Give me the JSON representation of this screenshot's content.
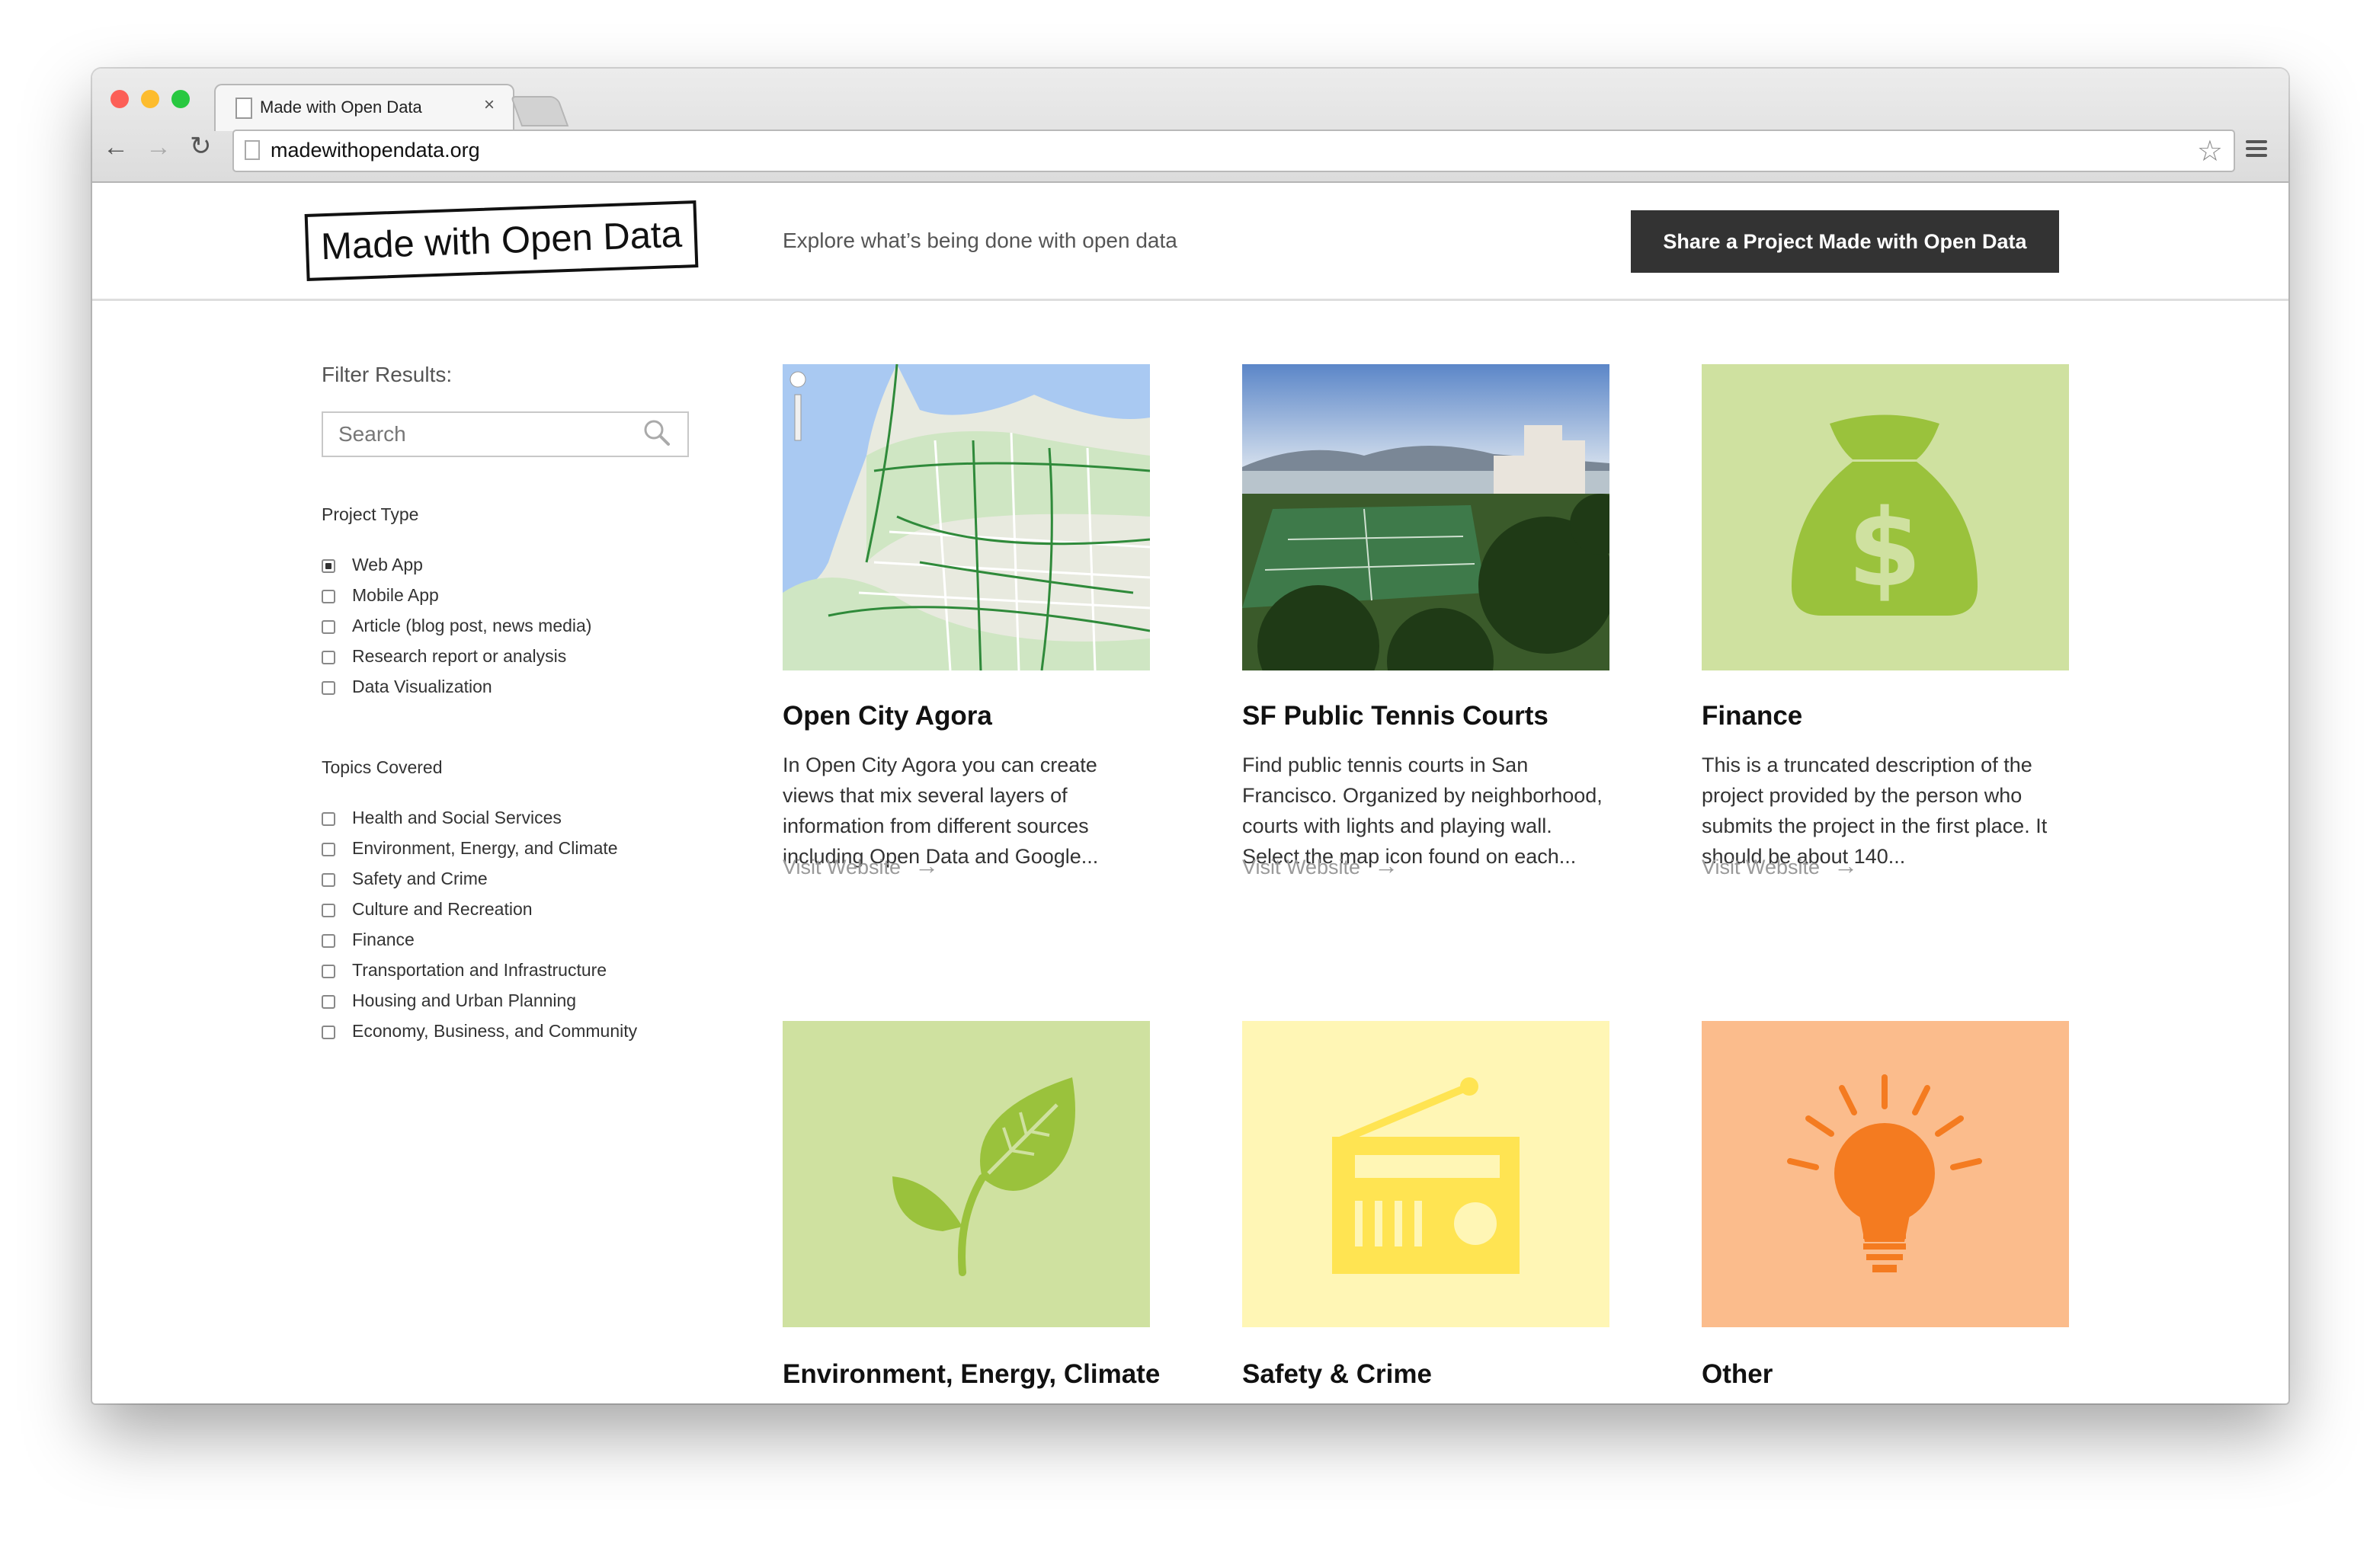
{
  "browser": {
    "tab_title": "Made with Open Data",
    "tab_close": "×",
    "url": "madewithopendata.org",
    "back_icon": "←",
    "forward_icon": "→",
    "reload_icon": "↻",
    "star_icon": "☆"
  },
  "header": {
    "logo_text": "Made with Open Data",
    "tagline": "Explore what’s being done with open data",
    "share_button": "Share a Project Made with Open Data"
  },
  "sidebar": {
    "filter_label": "Filter Results:",
    "search_placeholder": "Search",
    "project_type_title": "Project Type",
    "project_types": [
      {
        "label": "Web App",
        "checked": true
      },
      {
        "label": "Mobile App",
        "checked": false
      },
      {
        "label": "Article (blog post, news media)",
        "checked": false
      },
      {
        "label": "Research report or analysis",
        "checked": false
      },
      {
        "label": "Data Visualization",
        "checked": false
      }
    ],
    "topics_title": "Topics Covered",
    "topics": [
      {
        "label": "Health and Social Services",
        "checked": false
      },
      {
        "label": "Environment, Energy, and Climate",
        "checked": false
      },
      {
        "label": "Safety and Crime",
        "checked": false
      },
      {
        "label": "Culture and Recreation",
        "checked": false
      },
      {
        "label": "Finance",
        "checked": false
      },
      {
        "label": "Transportation and Infrastructure",
        "checked": false
      },
      {
        "label": "Housing and Urban Planning",
        "checked": false
      },
      {
        "label": "Economy, Business, and Community",
        "checked": false
      }
    ]
  },
  "cards": [
    {
      "title": "Open City Agora",
      "description": "In Open City Agora you can create views that mix several layers of information from different sources including Open Data and Google...",
      "visit": "Visit Website",
      "image": "map-thumbnail"
    },
    {
      "title": "SF Public Tennis Courts",
      "description": "Find public tennis courts in San Francisco. Organized by neighborhood, courts with lights and playing wall. Select the map icon found on each...",
      "visit": "Visit Website",
      "image": "tennis-photo"
    },
    {
      "title": "Finance",
      "description": "This is a truncated description of the project provided by the person who submits the project in the first place. It should be about 140...",
      "visit": "Visit Website",
      "image": "money-bag-icon"
    },
    {
      "title": "Environment, Energy, Climate",
      "image": "leaf-icon"
    },
    {
      "title": "Safety & Crime",
      "image": "radio-icon"
    },
    {
      "title": "Other",
      "image": "lightbulb-icon"
    }
  ],
  "colors": {
    "green_bg": "#cfe1a0",
    "green_icon": "#9ac23c",
    "yellow_bg": "#fff6b5",
    "yellow_icon": "#ffe452",
    "orange_bg": "#fbbc8c",
    "orange_icon": "#f47b20",
    "dark_button": "#333333"
  }
}
